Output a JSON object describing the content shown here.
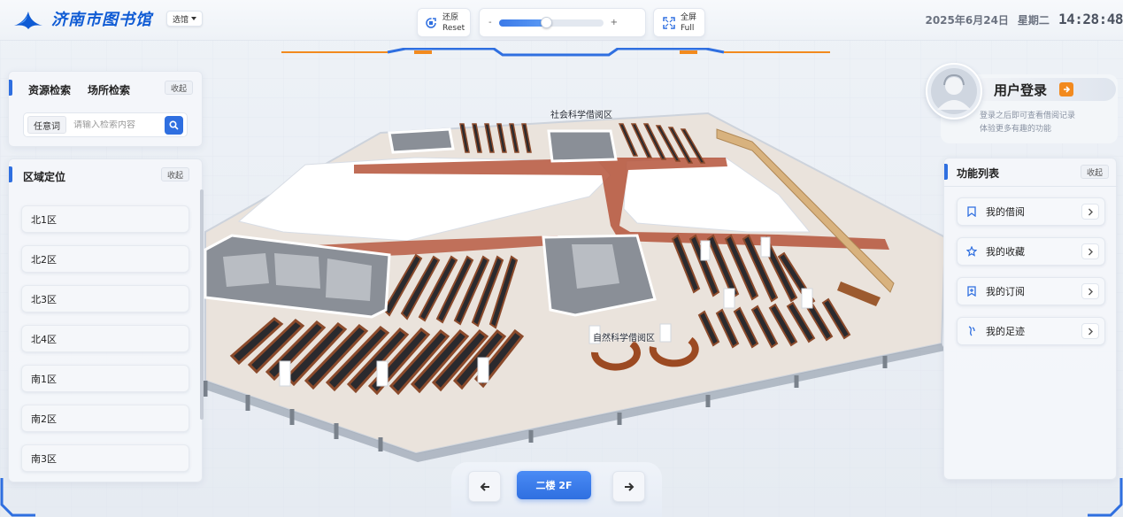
{
  "app": {
    "title": "济南市图书馆",
    "hall_select": "选馆",
    "brand_color": "#0f5bd4",
    "accent_color": "#2f6fe0",
    "orange_color": "#f28a1e"
  },
  "toolbar": {
    "reset_label": "还原",
    "reset_sub": "Reset",
    "fullscreen_label": "全屏",
    "fullscreen_sub": "Full",
    "zoom_minus": "-",
    "zoom_plus": "+",
    "zoom_level": 0.45
  },
  "datetime": {
    "date": "2025年6月24日",
    "weekday": "星期二",
    "time": "14:28:48"
  },
  "search": {
    "tabs": [
      {
        "label": "资源检索",
        "active": true
      },
      {
        "label": "场所检索",
        "active": false
      }
    ],
    "collapse_label": "收起",
    "type_label": "任意词",
    "placeholder": "请输入检索内容",
    "icon": "search-icon"
  },
  "area_nav": {
    "title": "区域定位",
    "collapse_label": "收起",
    "items": [
      "北1区",
      "北2区",
      "北3区",
      "北4区",
      "南1区",
      "南2区",
      "南3区"
    ]
  },
  "user": {
    "login_label": "用户登录",
    "hint_line1": "登录之后即可查看借阅记录",
    "hint_line2": "体验更多有趣的功能",
    "icon": "user-avatar-icon"
  },
  "functions": {
    "title": "功能列表",
    "collapse_label": "收起",
    "items": [
      {
        "label": "我的借阅",
        "icon": "bookmark-icon"
      },
      {
        "label": "我的收藏",
        "icon": "star-icon"
      },
      {
        "label": "我的订阅",
        "icon": "subscribe-icon"
      },
      {
        "label": "我的足迹",
        "icon": "footprint-icon"
      }
    ]
  },
  "floor": {
    "current": "二楼 2F",
    "prev_icon": "arrow-left-icon",
    "next_icon": "arrow-right-icon"
  },
  "map": {
    "labels": [
      "社会科学借阅区",
      "自然科学借阅区"
    ]
  }
}
